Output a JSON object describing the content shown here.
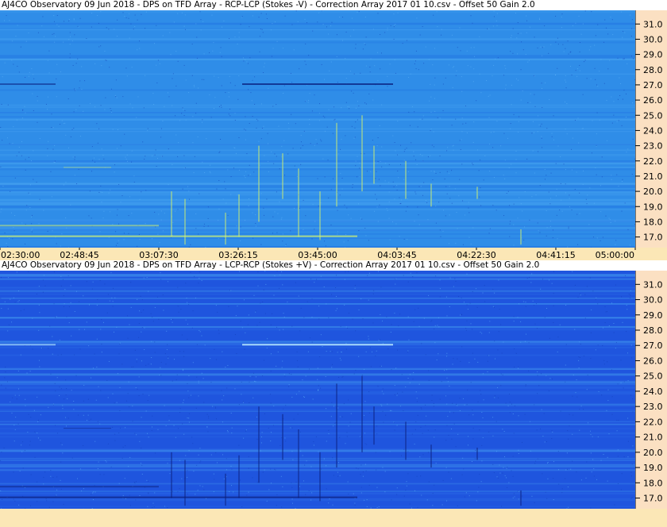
{
  "panels": [
    {
      "title": "AJ4CO Observatory 09 Jun 2018  -  DPS on TFD Array  -  RCP-LCP (Stokes -V)  -  Correction Array 2017 01 10.csv  -  Offset 50  Gain 2.0",
      "base_color": "#2f8de8",
      "band_color": "#1e6fe0",
      "bursts": "bright"
    },
    {
      "title": "AJ4CO Observatory 09 Jun 2018  -  DPS on TFD Array  -  LCP-RCP (Stokes +V)  -  Correction Array 2017 01 10.csv  -  Offset 50  Gain 2.0",
      "base_color": "#1f55de",
      "band_color": "#2a6ae6",
      "bursts": "dark"
    }
  ],
  "chart_data": {
    "type": "heatmap",
    "y_tick_labels": [
      "31.0",
      "30.0",
      "29.0",
      "28.0",
      "27.0",
      "26.0",
      "25.0",
      "24.0",
      "23.0",
      "22.0",
      "21.0",
      "20.0",
      "19.0",
      "18.0",
      "17.0"
    ],
    "y_values": [
      31.0,
      30.0,
      29.0,
      28.0,
      27.0,
      26.0,
      25.0,
      24.0,
      23.0,
      22.0,
      21.0,
      20.0,
      19.0,
      18.0,
      17.0
    ],
    "ylim": [
      16.3,
      31.9
    ],
    "x_tick_labels": [
      "02:30:00",
      "02:48:45",
      "03:07:30",
      "03:26:15",
      "03:45:00",
      "04:03:45",
      "04:22:30",
      "04:41:15",
      "05:00:00"
    ],
    "xlim": [
      "02:30:00",
      "05:00:00"
    ],
    "colormap": "blue spectrogram",
    "grid": false,
    "legend": "none"
  }
}
